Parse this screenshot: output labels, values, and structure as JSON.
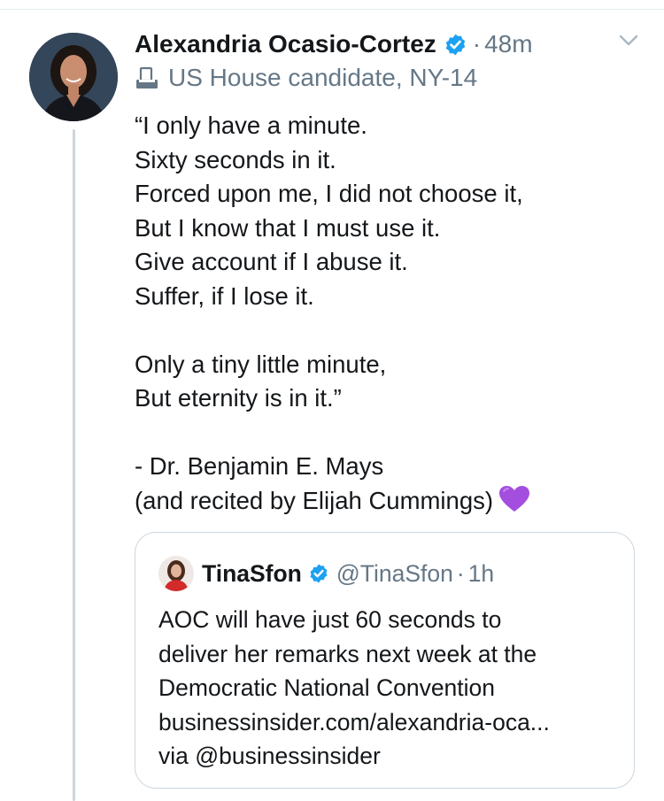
{
  "tweet": {
    "author_name": "Alexandria Ocasio-Cortez",
    "separator": "·",
    "time": "48m",
    "label": "US House candidate, NY-14",
    "body_lines": [
      "“I only have a minute.",
      "Sixty seconds in it.",
      "Forced upon me, I did not choose it,",
      "But I know that I must use it.",
      "Give account if I abuse it.",
      "Suffer, if I lose it.",
      "",
      "Only a tiny little minute,",
      "But eternity is in it.”",
      "",
      "- Dr. Benjamin E. Mays",
      "(and recited by Elijah Cummings)"
    ],
    "emoji": "💜"
  },
  "quoted": {
    "author_name": "TinaSfon",
    "handle": "@TinaSfon",
    "separator": "·",
    "time": "1h",
    "body_lines": [
      "AOC will have just 60 seconds to",
      "deliver her remarks next week at the",
      "Democratic National Convention",
      "businessinsider.com/alexandria-oca...",
      "via @businessinsider"
    ]
  },
  "colors": {
    "verified_blue": "#1da1f2",
    "secondary_text": "#657786",
    "heart_purple": "#a44ee0"
  },
  "icons": [
    "verified-badge-icon",
    "ballot-box-icon",
    "chevron-down-icon",
    "purple-heart-icon"
  ]
}
